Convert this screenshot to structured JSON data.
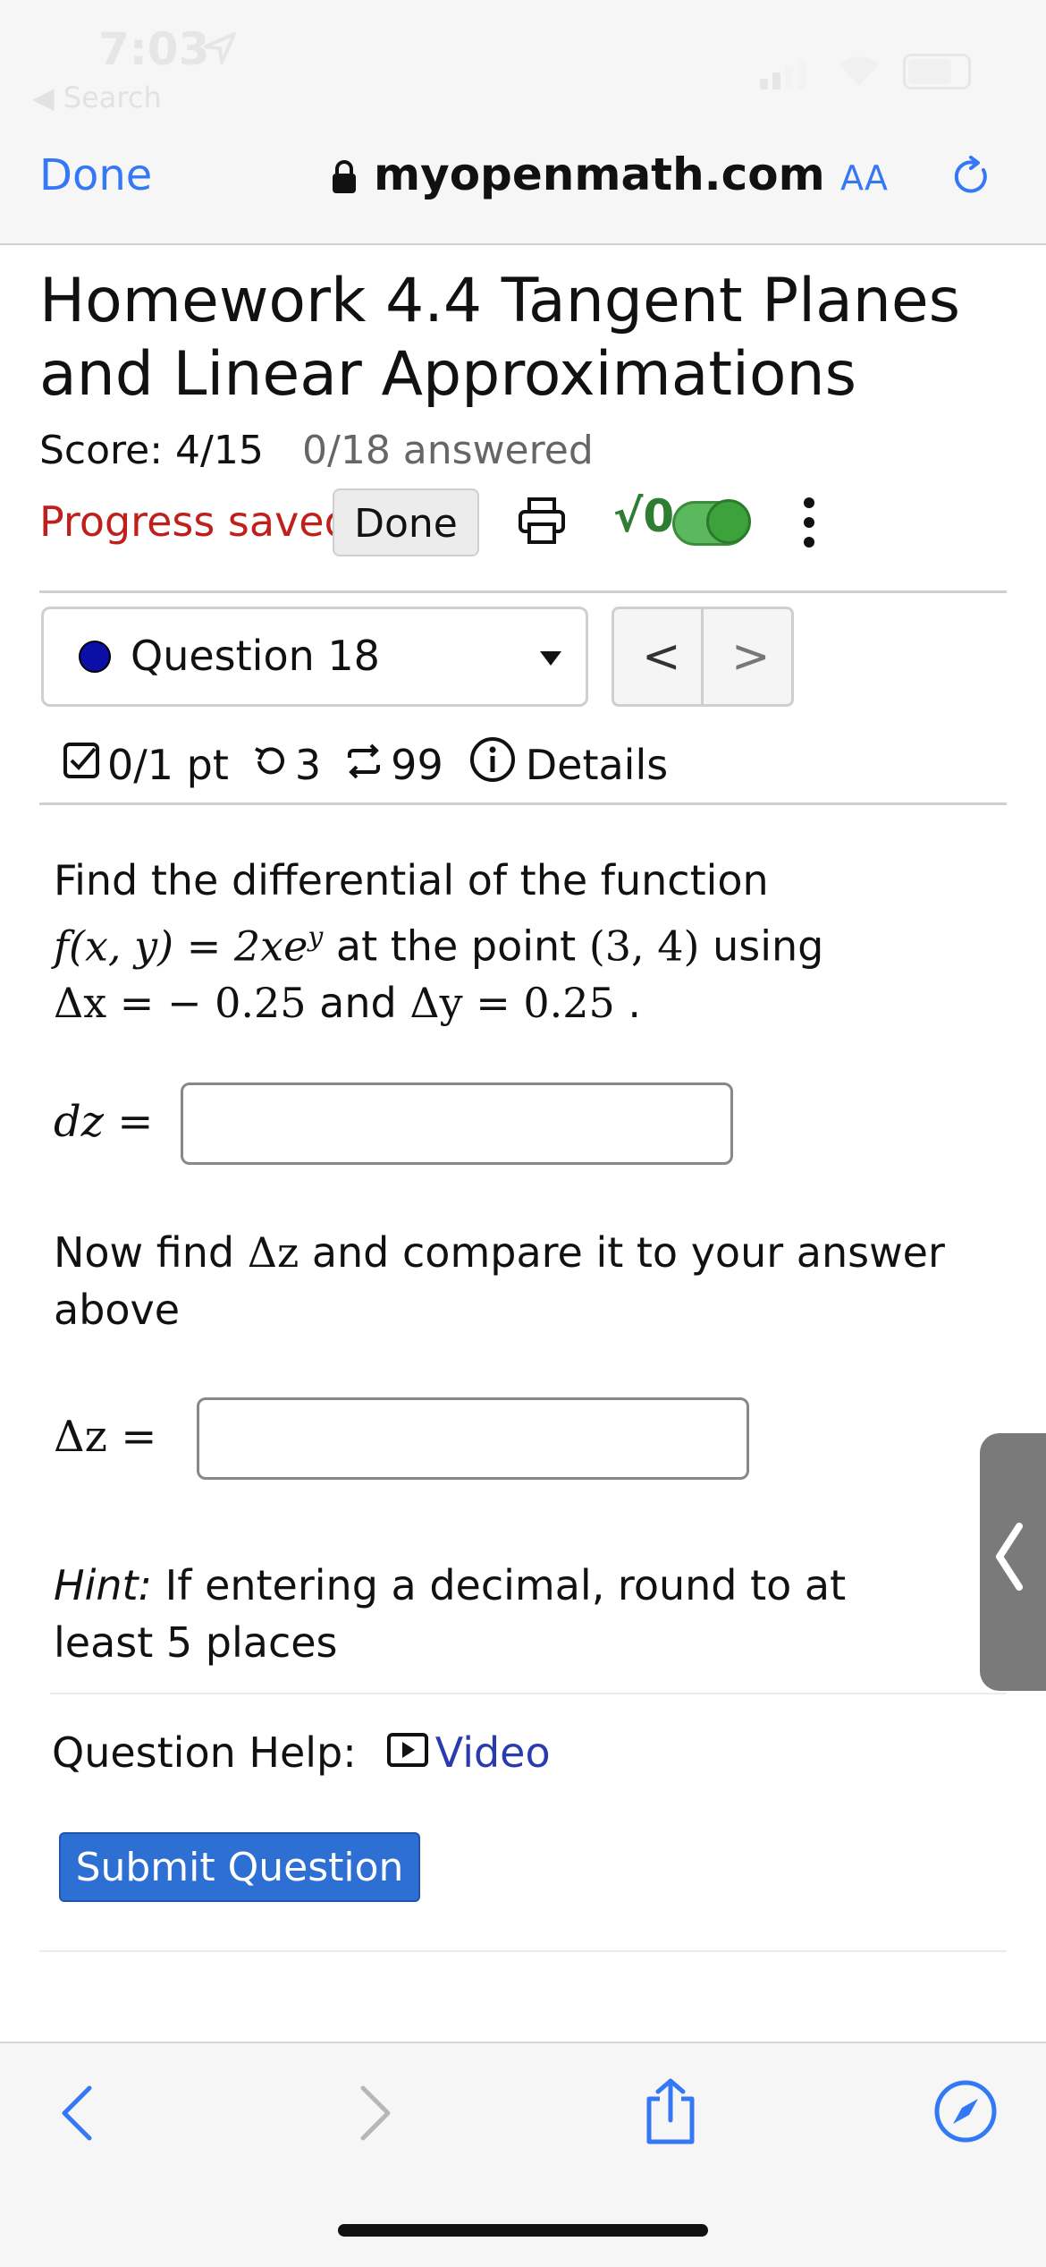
{
  "status_bar": {
    "time": "7:03",
    "back_app": "◀ Search"
  },
  "browser": {
    "done": "Done",
    "url": "myopenmath.com",
    "text_size": "AA"
  },
  "page": {
    "title": "Homework 4.4 Tangent Planes and Linear Approximations",
    "score": "Score: 4/15",
    "answered": "0/18 answered",
    "progress": "Progress saved",
    "done_button": "Done",
    "math_toggle": "√0"
  },
  "question_nav": {
    "selected": "Question 18",
    "prev": "<",
    "next": ">"
  },
  "meta": {
    "points": "0/1 pt",
    "retries": "3",
    "attempts": "99",
    "details": "Details"
  },
  "question": {
    "intro": "Find the differential of the function",
    "func": "f(x, y)",
    "eq": " = ",
    "expr": "2xe",
    "expr_sup": "y",
    "at_point": " at the point ",
    "point": "(3, 4)",
    "using": " using",
    "dx": "Δx",
    "dx_eq": " =  ",
    "dx_val": "− 0.25",
    "and": " and ",
    "dy": "Δy",
    "dy_eq": " = ",
    "dy_val": "0.25",
    "dot": "  .",
    "dz_label": "dz",
    "now_pre": "Now find ",
    "now_sym": "Δz",
    "now_post": " and compare it to your answer above",
    "Dz_label": "Δz",
    "hint_label": "Hint:",
    "hint_text": " If entering a decimal, round to at least 5 places",
    "help_label": "Question Help:",
    "video": "Video",
    "submit": "Submit Question"
  }
}
